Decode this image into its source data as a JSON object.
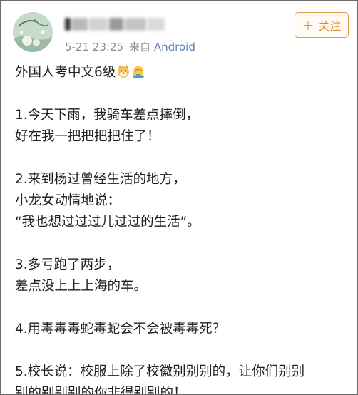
{
  "post": {
    "author": {
      "name_blurred": "",
      "time": "5-21 23:25",
      "source_prefix": "来自",
      "device": "Android"
    },
    "follow_button": {
      "label": "关注",
      "icon": "plus-icon"
    },
    "title": "外国人考中文6级",
    "title_emojis": [
      "doge-emoji",
      "facepalm-emoji"
    ],
    "items": [
      {
        "lines": [
          "1.今天下雨，我骑车差点摔倒，",
          "好在我一把把把把住了！"
        ]
      },
      {
        "lines": [
          "2.来到杨过曾经生活的地方，",
          "小龙女动情地说：",
          "“我也想过过过儿过过的生活”。"
        ]
      },
      {
        "lines": [
          "3.多亏跑了两步，",
          "差点没上上上海的车。"
        ]
      },
      {
        "lines": [
          "4.用毒毒毒蛇毒蛇会不会被毒毒死？"
        ]
      },
      {
        "lines": [
          "5.校长说：校服上除了校徽别别别的，让你们别别",
          "别的别别别的你非得别别的！"
        ]
      }
    ]
  },
  "colors": {
    "accent_follow": "#e08a2c",
    "meta_gray": "#8c8c8c",
    "device_blue": "#5b7fb5",
    "text": "#1f1f1f",
    "frame_border": "#6b6b6b"
  }
}
